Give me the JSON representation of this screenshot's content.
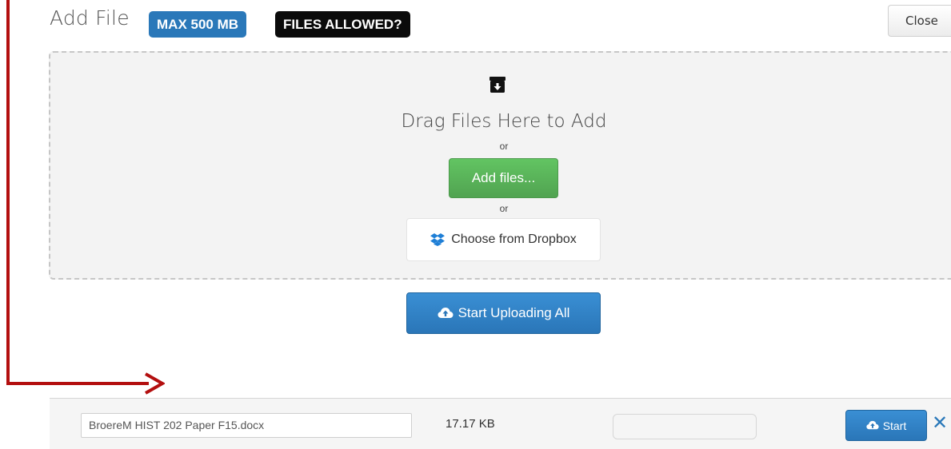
{
  "header": {
    "title": "Add File",
    "badge_max": "MAX 500 MB",
    "badge_types": "FILES ALLOWED?",
    "close_label": "Close"
  },
  "dropzone": {
    "icon": "download-box-icon",
    "text": "Drag Files Here to Add",
    "or1": "or",
    "add_files_label": "Add files...",
    "or2": "or",
    "dropbox_label": "Choose from Dropbox"
  },
  "upload": {
    "start_all_label": "Start Uploading All"
  },
  "file_row": {
    "file_name": "BroereM HIST 202 Paper F15.docx",
    "file_size": "17.17 KB",
    "progress": 0,
    "start_label": "Start",
    "remove_icon": "close-x-icon"
  },
  "colors": {
    "primary": "#2a78b9",
    "success": "#5bb75b",
    "annotation": "#b30f0f",
    "badge_dark": "#0b0b0b"
  }
}
